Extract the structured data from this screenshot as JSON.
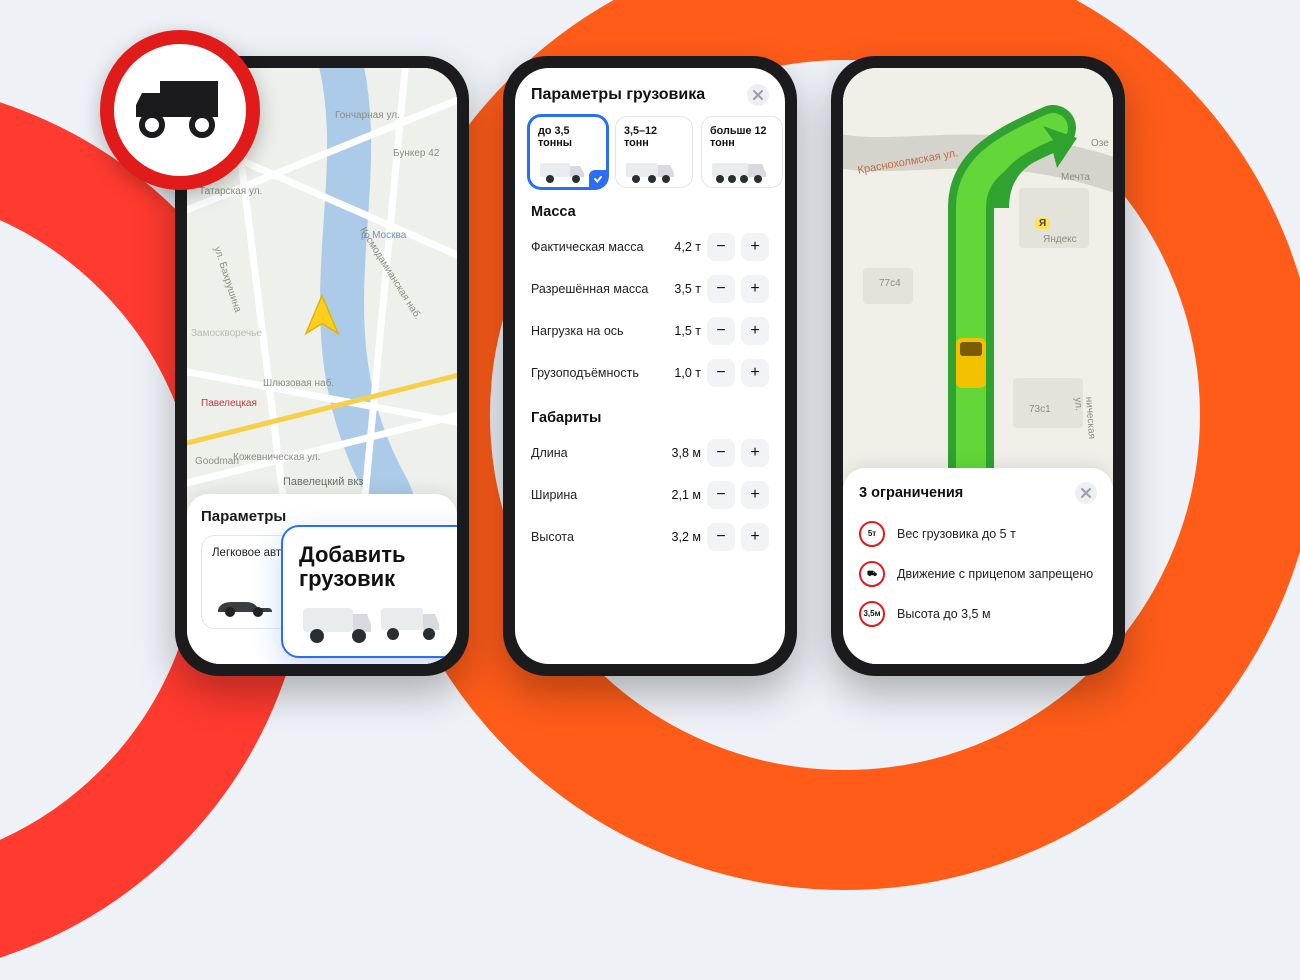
{
  "background": {
    "accent_red": "#ff3a2f",
    "accent_orange": "#ff5c19",
    "truck_sign": "truck-icon"
  },
  "phone1": {
    "sheet_title": "Параметры",
    "map_labels": [
      "Татарская ул.",
      "Космодамианская наб.",
      "Шлюзовая наб.",
      "Гончарная ул.",
      "Кожевническая ул.",
      "Павелецкий вкз",
      "Павелецкая",
      "р. Москва",
      "Бункер 42",
      "Goodman",
      "ул. Бахрушина",
      "Замоскворечье"
    ],
    "vehicle_options": [
      {
        "label": "Легковое авто",
        "selected": false
      },
      {
        "label": "Добавить грузовик",
        "selected": true
      }
    ]
  },
  "phone2": {
    "title": "Параметры грузовика",
    "weight_classes": [
      {
        "label": "до 3,5 тонны",
        "selected": true
      },
      {
        "label": "3,5–12 тонн",
        "selected": false
      },
      {
        "label": "больше 12 тонн",
        "selected": false
      }
    ],
    "sections": {
      "mass": {
        "title": "Масса",
        "items": [
          {
            "name": "Фактическая масса",
            "value": "4,2 т"
          },
          {
            "name": "Разрешённая масса",
            "value": "3,5 т"
          },
          {
            "name": "Нагрузка на ось",
            "value": "1,5 т"
          },
          {
            "name": "Грузоподъёмность",
            "value": "1,0 т"
          }
        ]
      },
      "dimensions": {
        "title": "Габариты",
        "items": [
          {
            "name": "Длина",
            "value": "3,8 м"
          },
          {
            "name": "Ширина",
            "value": "2,1 м"
          },
          {
            "name": "Высота",
            "value": "3,2 м"
          }
        ]
      }
    }
  },
  "phone3": {
    "title": "3 ограничения",
    "map_labels": [
      "Краснохолмская ул.",
      "Мечта",
      "Яндекс",
      "Озе",
      "ническая ул.",
      "77с4",
      "73с1",
      "Я"
    ],
    "restrictions": [
      {
        "badge": "5т",
        "text": "Вес грузовика до 5 т"
      },
      {
        "badge": "⛟",
        "text": "Движение с прицепом запрещено"
      },
      {
        "badge": "3,5м",
        "text": "Высота до 3,5 м"
      }
    ]
  }
}
